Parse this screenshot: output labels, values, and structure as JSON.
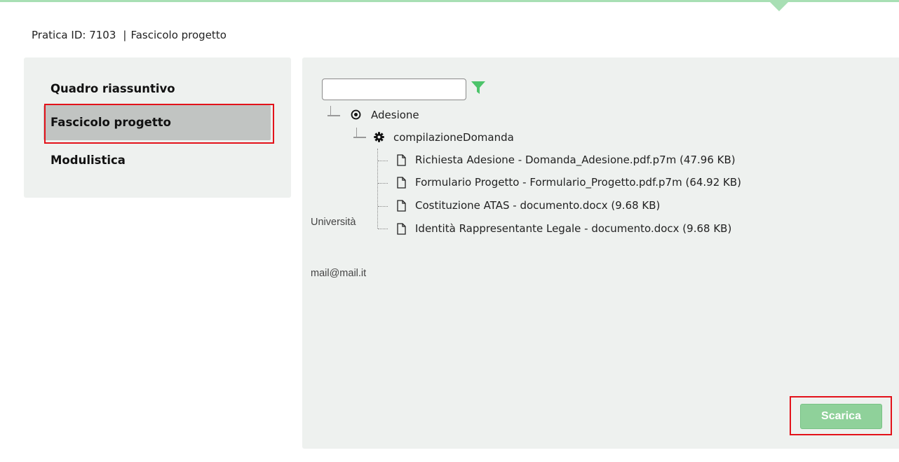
{
  "breadcrumb": {
    "pratica": "Pratica ID: 7103",
    "separator": "|",
    "section": "Fascicolo progetto"
  },
  "sidebar": {
    "items": [
      {
        "label": "Quadro riassuntivo",
        "active": false
      },
      {
        "label": "Fascicolo progetto",
        "active": true
      },
      {
        "label": "Modulistica",
        "active": false
      }
    ]
  },
  "tree": {
    "filter": {
      "value": "",
      "placeholder": "",
      "icon": "filter-icon"
    },
    "root": {
      "label": "Adesione",
      "icon": "radio-target-icon"
    },
    "child": {
      "label": "compilazioneDomanda",
      "icon": "gear-icon"
    },
    "files": [
      {
        "label": "Richiesta Adesione - Domanda_Adesione.pdf.p7m (47.96 KB)",
        "icon": "file-icon"
      },
      {
        "label": "Formulario Progetto - Formulario_Progetto.pdf.p7m (64.92 KB)",
        "icon": "file-icon"
      },
      {
        "label": "Costituzione ATAS - documento.docx (9.68 KB)",
        "icon": "file-icon"
      },
      {
        "label": "Identità Rappresentante Legale - documento.docx (9.68 KB)",
        "icon": "file-icon"
      }
    ]
  },
  "overlay_text": {
    "universita": "Università",
    "email": "mail@mail.it"
  },
  "actions": {
    "download_label": "Scarica"
  },
  "colors": {
    "accent_green": "#8fd19a",
    "highlight_red": "#e3121a",
    "panel_bg": "#eef1ef",
    "active_item_bg": "#c1c4c2"
  }
}
